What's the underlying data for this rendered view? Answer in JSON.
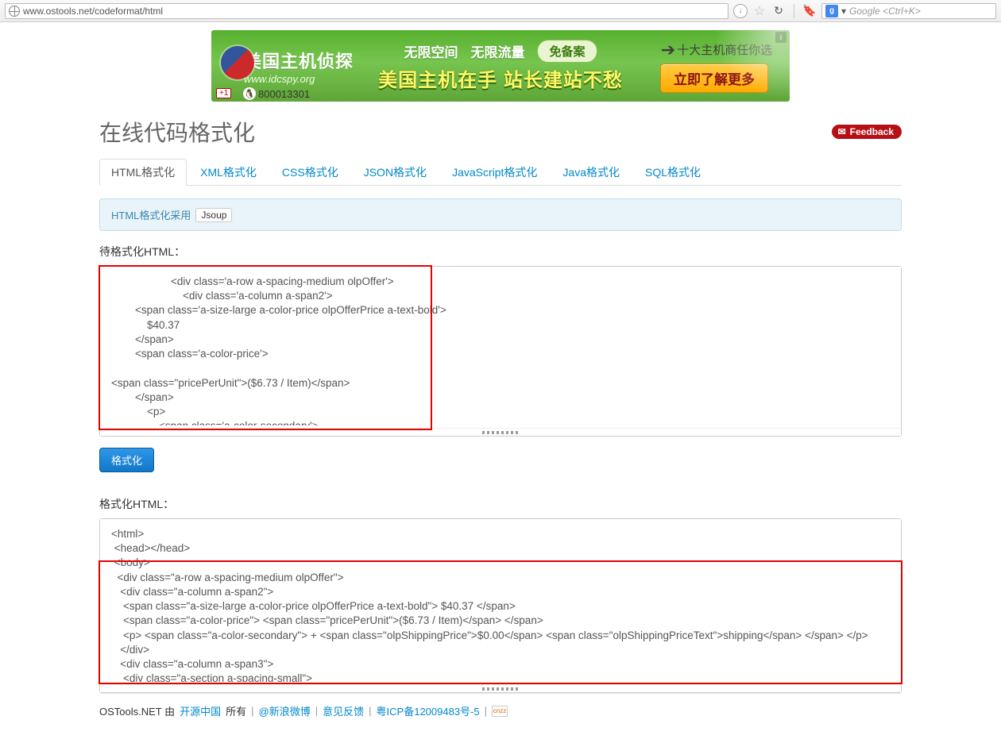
{
  "browser": {
    "url": "www.ostools.net/codeformat/html",
    "search_placeholder": "Google <Ctrl+K>"
  },
  "banner": {
    "brand_cn": "美国主机侦探",
    "brand_url": "www.idcspy.org",
    "qq": "800013301",
    "plus": "+1",
    "feature1": "无限空间",
    "feature2": "无限流量",
    "pill": "免备案",
    "big_line": "美国主机在手 站长建站不愁",
    "slogan": "十大主机商任你选",
    "cta": "立即了解更多"
  },
  "page": {
    "title": "在线代码格式化",
    "feedback": "Feedback"
  },
  "tabs": [
    {
      "label": "HTML格式化",
      "active": true
    },
    {
      "label": "XML格式化"
    },
    {
      "label": "CSS格式化"
    },
    {
      "label": "JSON格式化"
    },
    {
      "label": "JavaScript格式化"
    },
    {
      "label": "Java格式化"
    },
    {
      "label": "SQL格式化"
    }
  ],
  "info": {
    "text": "HTML格式化采用",
    "lib": "Jsoup"
  },
  "labels": {
    "input": "待格式化HTML：",
    "output": "格式化HTML："
  },
  "button": {
    "format": "格式化"
  },
  "input_html": "                    <div class='a-row a-spacing-medium olpOffer'>\n                        <div class='a-column a-span2'>\n        <span class='a-size-large a-color-price olpOfferPrice a-text-bold'>\n            $40.37\n        </span>\n        <span class='a-color-price'>\n            \n<span class=\"pricePerUnit\">($6.73 / Item)</span>\n        </span>\n            <p>\n                <span class='a-color-secondary'>",
  "output_html": "<html>\n <head></head>\n <body>\n  <div class=\"a-row a-spacing-medium olpOffer\">\n   <div class=\"a-column a-span2\">\n    <span class=\"a-size-large a-color-price olpOfferPrice a-text-bold\"> $40.37 </span>\n    <span class=\"a-color-price\"> <span class=\"pricePerUnit\">($6.73 / Item)</span> </span>\n    <p> <span class=\"a-color-secondary\"> + <span class=\"olpShippingPrice\">$0.00</span> <span class=\"olpShippingPriceText\">shipping</span> </span> </p>\n   </div>\n   <div class=\"a-column a-span3\">\n    <div class=\"a-section a-spacing-small\">",
  "footer": {
    "brand": "OSTools.NET 由",
    "link_oschina": "开源中国",
    "owned": "所有",
    "link_weibo": "@新浪微博",
    "link_feedback": "意见反馈",
    "link_icp": "粤ICP备12009483号-5"
  }
}
